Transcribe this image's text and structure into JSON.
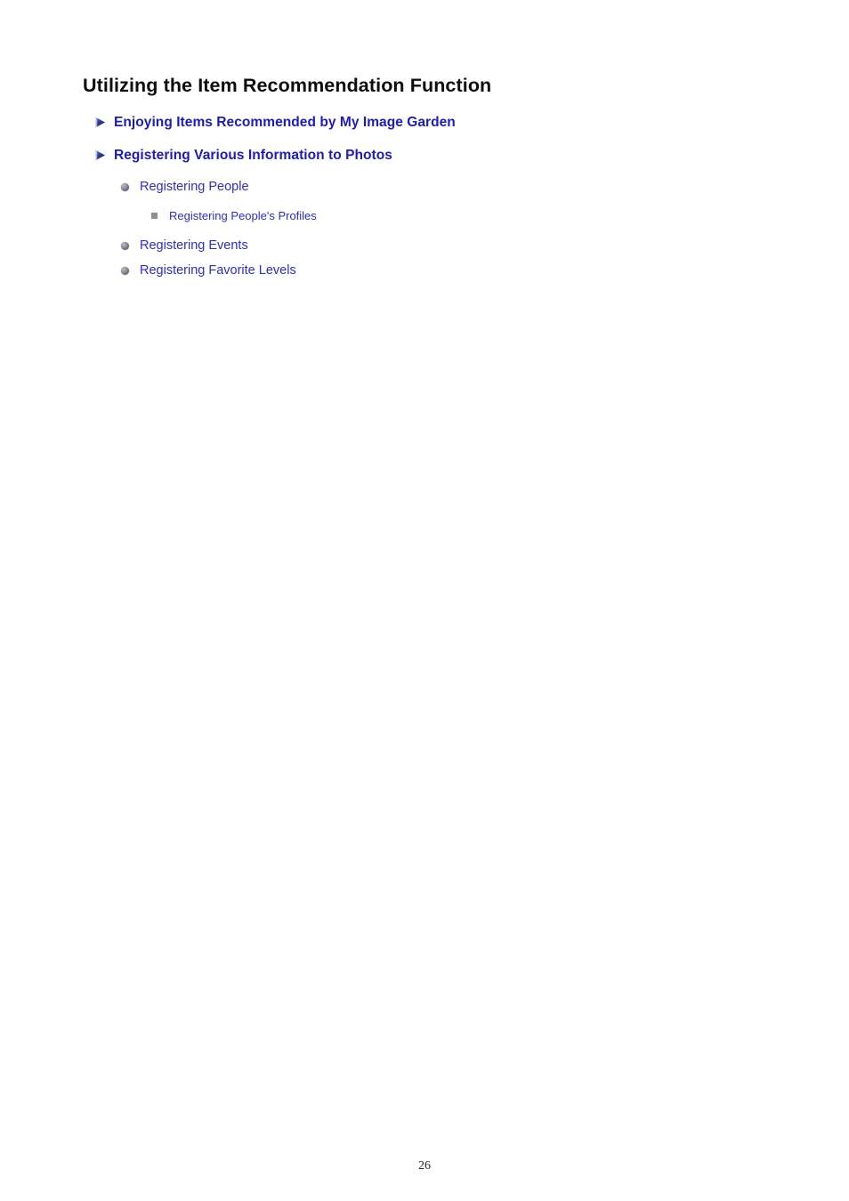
{
  "document": {
    "title": "Utilizing the Item Recommendation Function",
    "page_number": "26",
    "background_color": "#ffffff",
    "title_color": "#0d0d0d",
    "link_color_level1": "#1a1ac8",
    "link_color_sub": "#2b2be0",
    "bullet_color_circle": "#6f727d",
    "bullet_color_square": "#8d8f96",
    "bullet_color_arrow": "#1f2d8a"
  },
  "toc": {
    "items": [
      {
        "level": 1,
        "label": "Enjoying Items Recommended by My Image Garden",
        "bullet": "arrow-right-icon"
      },
      {
        "level": 1,
        "label": "Registering Various Information to Photos",
        "bullet": "arrow-right-icon"
      },
      {
        "level": 2,
        "label": "Registering People",
        "bullet": "circle-bullet-icon"
      },
      {
        "level": 3,
        "label": "Registering People's Profiles",
        "bullet": "square-bullet-icon"
      },
      {
        "level": 2,
        "label": "Registering Events",
        "bullet": "circle-bullet-icon"
      },
      {
        "level": 2,
        "label": "Registering Favorite Levels",
        "bullet": "circle-bullet-icon"
      }
    ]
  }
}
